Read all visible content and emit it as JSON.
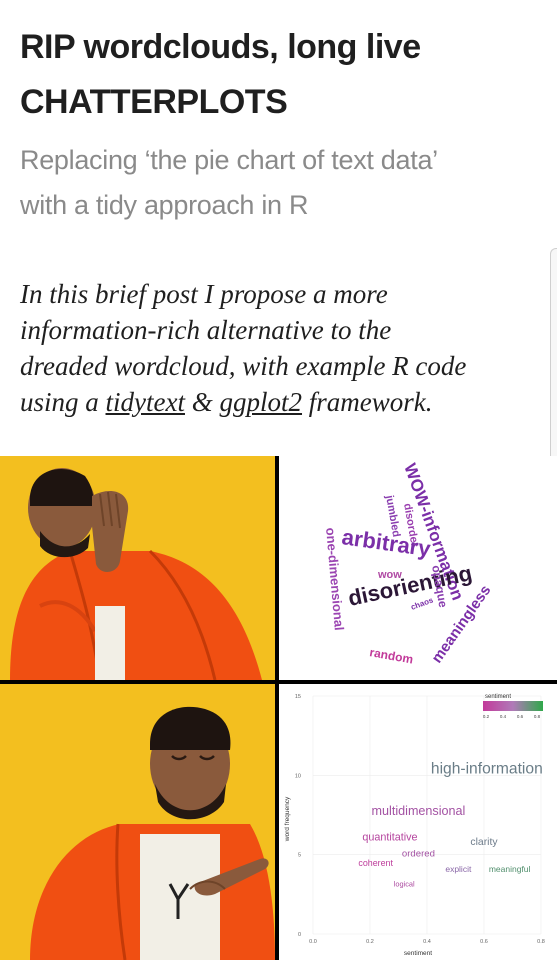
{
  "article": {
    "title_line1": "RIP wordclouds, long live",
    "title_line2": "CHATTERPLOTS",
    "subtitle_line1": "Replacing ‘the pie chart of text data’",
    "subtitle_line2": "with a tidy approach in R",
    "intro_line1": "In this brief post I propose a more",
    "intro_line2": "information-rich alternative to the",
    "intro_line3": "dreaded wordcloud, with example R code",
    "intro_line4_pre": "using a ",
    "intro_link1": "tidytext",
    "intro_line4_mid": " & ",
    "intro_link2": "ggplot2",
    "intro_line4_post": " framework."
  },
  "meme": {
    "wordcloud_words": [
      "arbitrary",
      "disorienting",
      "one-dimensional",
      "WOW-information",
      "jumbled",
      "disorder",
      "opaque",
      "wow",
      "chaos",
      "meaningless",
      "random"
    ],
    "colors": {
      "background": "#f2bb12",
      "jacket": "#f04f12",
      "purple": "#7b2fa8",
      "green": "#2fa84a",
      "pink": "#c23a9a"
    }
  },
  "chart_data": {
    "type": "scatter",
    "xlabel": "sentiment",
    "ylabel": "word frequency",
    "xlim": [
      0,
      0.8
    ],
    "ylim": [
      0,
      15
    ],
    "x_ticks": [
      "0.0",
      "0.2",
      "0.4",
      "0.6",
      "0.8"
    ],
    "y_ticks": [
      "0",
      "5",
      "10",
      "15"
    ],
    "legend": {
      "title": "sentiment",
      "ticks": [
        "0.2",
        "0.4",
        "0.6",
        "0.8"
      ],
      "placement": "top-right"
    },
    "points": [
      {
        "label": "high-information",
        "x": 0.61,
        "y": 10.1
      },
      {
        "label": "multidimensional",
        "x": 0.37,
        "y": 7.5
      },
      {
        "label": "quantitative",
        "x": 0.27,
        "y": 5.9
      },
      {
        "label": "clarity",
        "x": 0.6,
        "y": 5.6
      },
      {
        "label": "ordered",
        "x": 0.37,
        "y": 4.9
      },
      {
        "label": "coherent",
        "x": 0.22,
        "y": 4.3
      },
      {
        "label": "explicit",
        "x": 0.51,
        "y": 3.9
      },
      {
        "label": "meaningful",
        "x": 0.69,
        "y": 3.9
      },
      {
        "label": "logical",
        "x": 0.32,
        "y": 3.0
      }
    ]
  }
}
